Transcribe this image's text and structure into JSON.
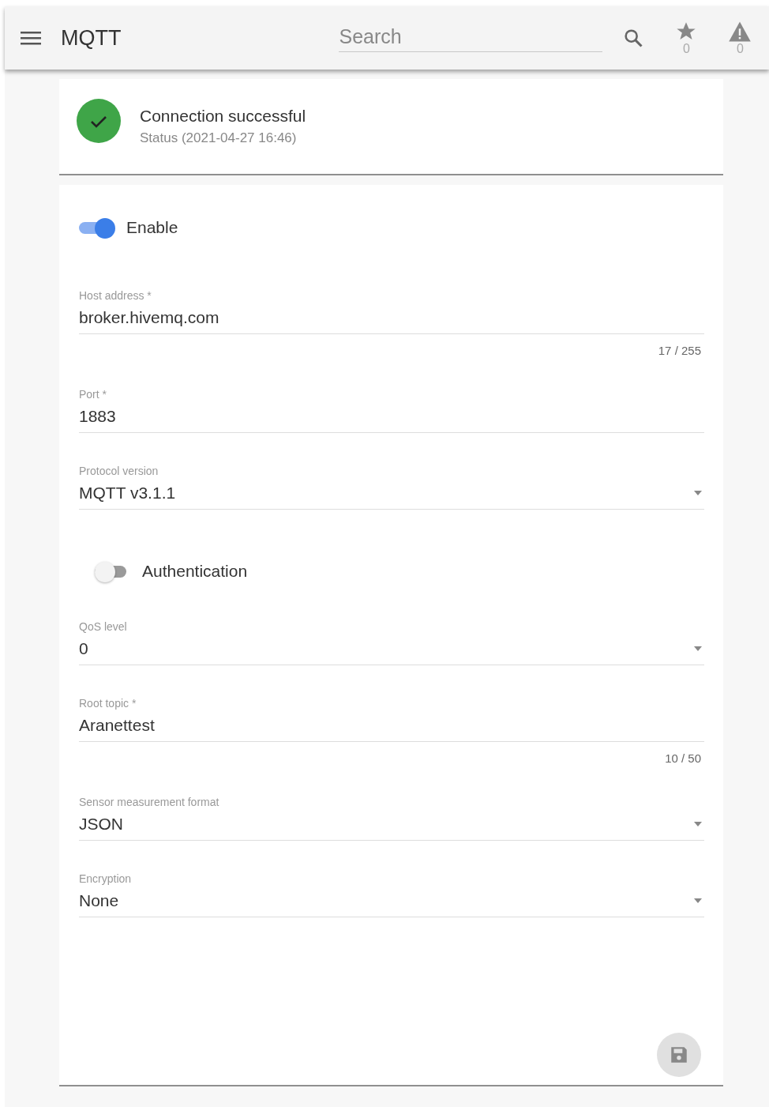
{
  "app_bar": {
    "title": "MQTT",
    "search": {
      "placeholder": "Search"
    },
    "counters": [
      {
        "kind": "star",
        "count": "0"
      },
      {
        "kind": "alert",
        "count": "0"
      }
    ]
  },
  "status": {
    "ok": true,
    "title": "Connection successful",
    "subtitle": "Status (2021-04-27 16:46)"
  },
  "form": {
    "items": [
      {
        "kind": "toggle",
        "label": "Enable",
        "on": true
      },
      {
        "kind": "text",
        "label": "Host address *",
        "value": "broker.hivemq.com",
        "counter": "17 / 255"
      },
      {
        "kind": "text",
        "label": "Port *",
        "value": "1883"
      },
      {
        "kind": "select",
        "label": "Protocol version",
        "value": "MQTT v3.1.1"
      },
      {
        "kind": "toggle",
        "label": "Authentication",
        "on": false
      },
      {
        "kind": "select",
        "label": "QoS level",
        "value": "0"
      },
      {
        "kind": "text",
        "label": "Root topic *",
        "value": "Aranettest",
        "counter": "10 / 50"
      },
      {
        "kind": "select",
        "label": "Sensor measurement format",
        "value": "JSON"
      },
      {
        "kind": "select",
        "label": "Encryption",
        "value": "None"
      }
    ]
  }
}
